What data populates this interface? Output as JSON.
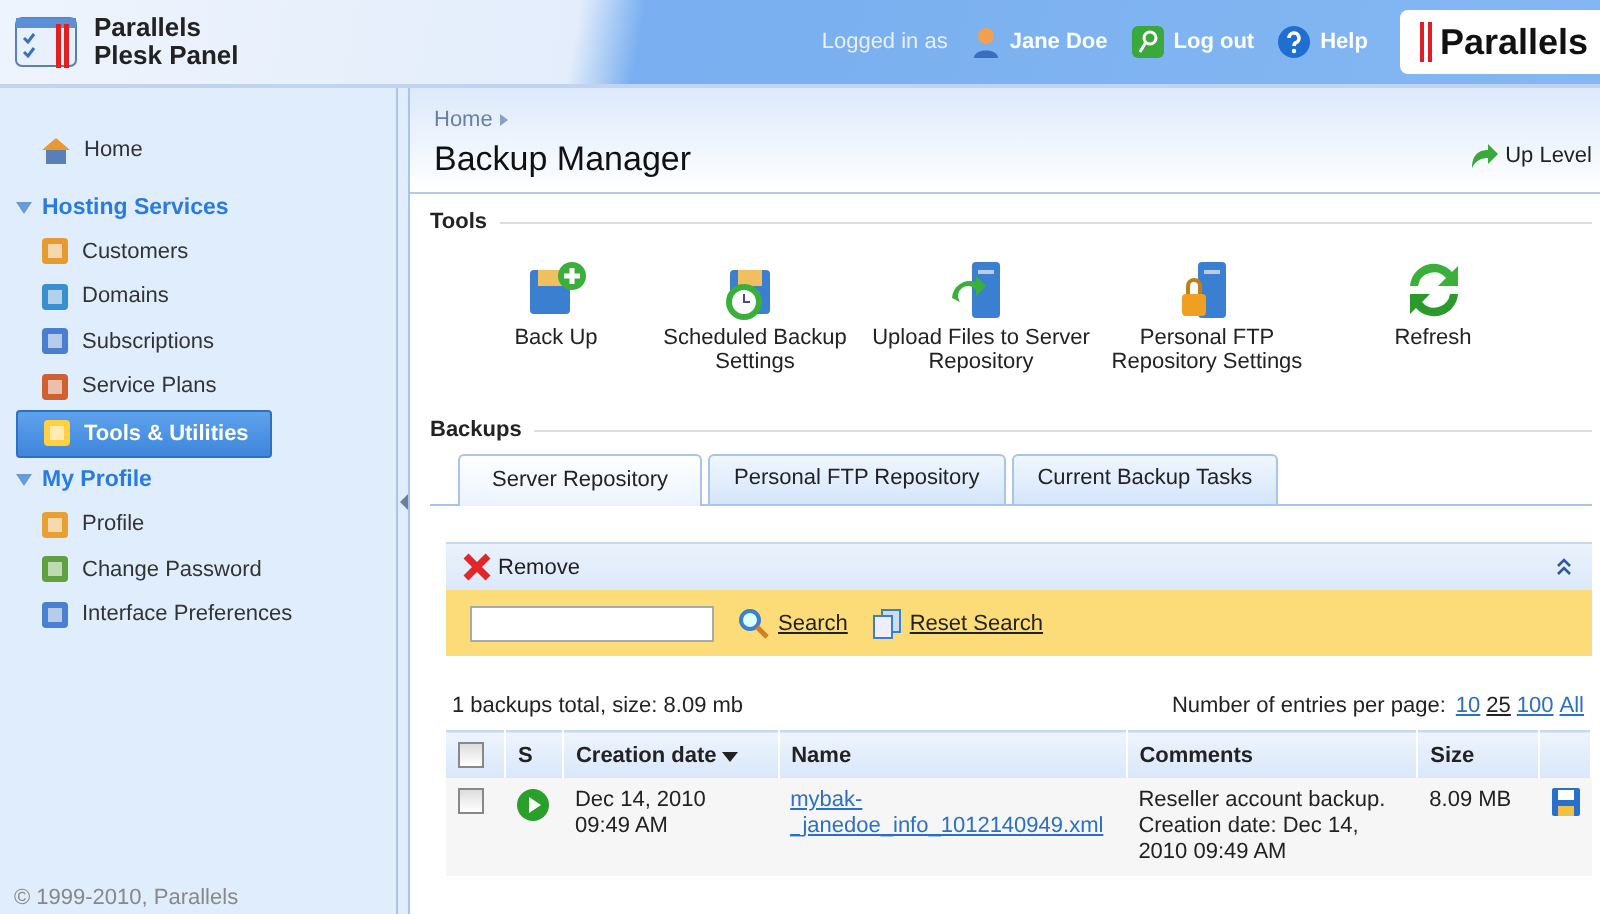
{
  "app": {
    "name_line_1": "Parallels",
    "name_line_2": "Plesk Panel"
  },
  "header": {
    "logged_in_label": "Logged in as",
    "user": "Jane Doe",
    "logout": "Log out",
    "help": "Help",
    "brand": "Parallels"
  },
  "sidebar": {
    "home": "Home",
    "sections": [
      {
        "title": "Hosting Services",
        "expanded": true,
        "items": [
          {
            "label": "Customers",
            "selected": false
          },
          {
            "label": "Domains",
            "selected": false
          },
          {
            "label": "Subscriptions",
            "selected": false
          },
          {
            "label": "Service Plans",
            "selected": false
          },
          {
            "label": "Tools & Utilities",
            "selected": true
          }
        ]
      },
      {
        "title": "My Profile",
        "expanded": true,
        "items": [
          {
            "label": "Profile",
            "selected": false
          },
          {
            "label": "Change Password",
            "selected": false
          },
          {
            "label": "Interface Preferences",
            "selected": false
          }
        ]
      }
    ],
    "copyright": "© 1999-2010, Parallels"
  },
  "breadcrumb": [
    "Home"
  ],
  "page_title": "Backup Manager",
  "up_level": "Up Level",
  "tools": {
    "title": "Tools",
    "items": [
      {
        "label": "Back Up"
      },
      {
        "label": "Scheduled Backup Settings"
      },
      {
        "label": "Upload Files to Server Repository"
      },
      {
        "label": "Personal FTP Repository Settings"
      },
      {
        "label": "Refresh"
      }
    ]
  },
  "backups": {
    "title": "Backups",
    "tabs": [
      {
        "label": "Server Repository",
        "selected": true
      },
      {
        "label": "Personal FTP Repository",
        "selected": false
      },
      {
        "label": "Current Backup Tasks",
        "selected": false
      }
    ],
    "remove": "Remove",
    "search_button": "Search",
    "reset_search": "Reset Search",
    "summary": "1 backups total, size: 8.09 mb",
    "per_page_label": "Number of entries per page:",
    "per_page": [
      {
        "label": "10",
        "selected": false
      },
      {
        "label": "25",
        "selected": true
      },
      {
        "label": "100",
        "selected": false
      },
      {
        "label": "All",
        "selected": false
      }
    ],
    "table": {
      "all_checked": false,
      "columns": [
        {
          "label": "S",
          "sorted": false
        },
        {
          "label": "Creation date",
          "sorted": true
        },
        {
          "label": "Name",
          "sorted": false
        },
        {
          "label": "Comments",
          "sorted": false
        },
        {
          "label": "Size",
          "sorted": false
        }
      ],
      "rows": [
        {
          "checked": false,
          "creation_date": "Dec 14, 2010 09:49 AM",
          "name": "mybak-_janedoe_info_1012140949.xml",
          "comments": "Reseller account backup. Creation date: Dec 14, 2010 09:49 AM",
          "size": "8.09 MB"
        }
      ]
    }
  }
}
